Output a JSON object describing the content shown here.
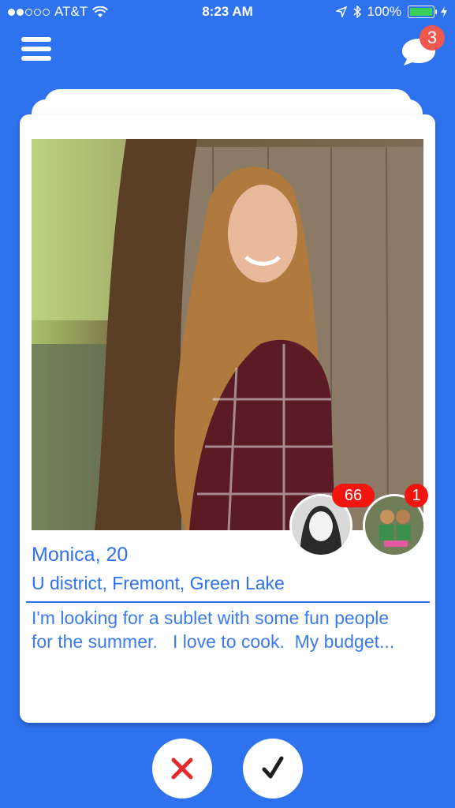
{
  "status_bar": {
    "carrier": "AT&T",
    "signal_bars_filled": 2,
    "signal_bars_total": 5,
    "time": "8:23 AM",
    "battery_percent": "100%",
    "battery_level": 1.0
  },
  "header": {
    "menu_icon": "hamburger-menu-icon",
    "chat_icon": "chat-bubble-icon",
    "chat_badge": "3"
  },
  "profile": {
    "name_age": "Monica, 20",
    "locations": "U district, Fremont, Green Lake",
    "description": "I'm looking for a sublet with some fun people\nfor the summer.   I love to cook.  My budget...",
    "mutual_one_count": "66",
    "mutual_two_count": "1"
  },
  "actions": {
    "reject_icon": "x-icon",
    "accept_icon": "check-icon"
  },
  "colors": {
    "brand_blue": "#2f72ee",
    "badge_red": "#f2150f",
    "chat_badge_red": "#f0574f",
    "reject_red": "#e32a2a",
    "battery_green": "#3ad15b"
  }
}
